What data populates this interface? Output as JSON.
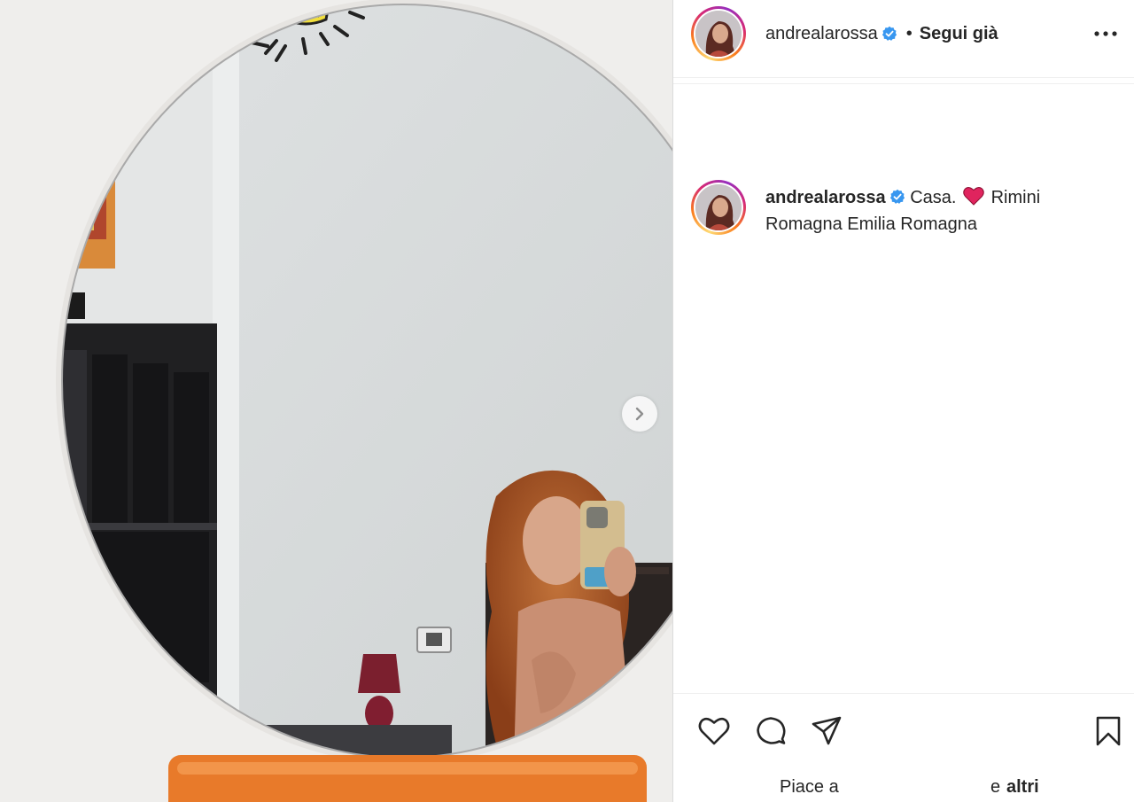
{
  "post": {
    "username": "andrealarossa",
    "verified": true,
    "separator": "•",
    "follow_label": "Segui già",
    "more_label": "Altre opzioni"
  },
  "caption": {
    "username": "andrealarossa",
    "text_before": "Casa.",
    "text_after": "Rimini Romagna Emilia Romagna"
  },
  "likes": {
    "prefix": "Piace a",
    "suffix_partial": "e",
    "others_label": "altri"
  },
  "icons": {
    "like": "heart-outline-icon",
    "comment": "comment-bubble-icon",
    "share": "paper-plane-icon",
    "save": "bookmark-icon",
    "next": "chevron-right-icon",
    "verified": "verified-badge-icon"
  },
  "colors": {
    "verified_blue": "#3897f0",
    "heart_red": "#e0245e",
    "text": "#262626",
    "border": "#dbdbdb"
  }
}
